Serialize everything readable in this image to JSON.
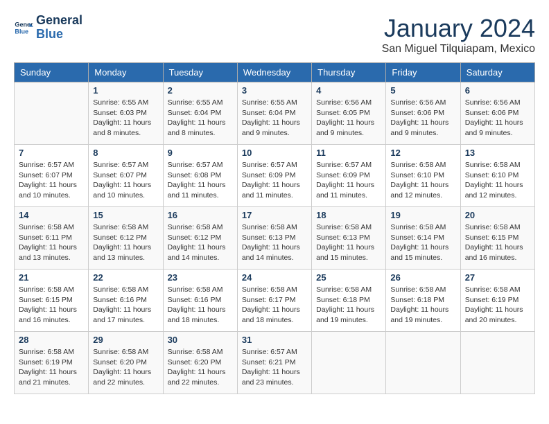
{
  "header": {
    "logo_line1": "General",
    "logo_line2": "Blue",
    "month": "January 2024",
    "location": "San Miguel Tilquiapam, Mexico"
  },
  "weekdays": [
    "Sunday",
    "Monday",
    "Tuesday",
    "Wednesday",
    "Thursday",
    "Friday",
    "Saturday"
  ],
  "weeks": [
    [
      {
        "day": "",
        "info": ""
      },
      {
        "day": "1",
        "info": "Sunrise: 6:55 AM\nSunset: 6:03 PM\nDaylight: 11 hours\nand 8 minutes."
      },
      {
        "day": "2",
        "info": "Sunrise: 6:55 AM\nSunset: 6:04 PM\nDaylight: 11 hours\nand 8 minutes."
      },
      {
        "day": "3",
        "info": "Sunrise: 6:55 AM\nSunset: 6:04 PM\nDaylight: 11 hours\nand 9 minutes."
      },
      {
        "day": "4",
        "info": "Sunrise: 6:56 AM\nSunset: 6:05 PM\nDaylight: 11 hours\nand 9 minutes."
      },
      {
        "day": "5",
        "info": "Sunrise: 6:56 AM\nSunset: 6:06 PM\nDaylight: 11 hours\nand 9 minutes."
      },
      {
        "day": "6",
        "info": "Sunrise: 6:56 AM\nSunset: 6:06 PM\nDaylight: 11 hours\nand 9 minutes."
      }
    ],
    [
      {
        "day": "7",
        "info": "Sunrise: 6:57 AM\nSunset: 6:07 PM\nDaylight: 11 hours\nand 10 minutes."
      },
      {
        "day": "8",
        "info": "Sunrise: 6:57 AM\nSunset: 6:07 PM\nDaylight: 11 hours\nand 10 minutes."
      },
      {
        "day": "9",
        "info": "Sunrise: 6:57 AM\nSunset: 6:08 PM\nDaylight: 11 hours\nand 11 minutes."
      },
      {
        "day": "10",
        "info": "Sunrise: 6:57 AM\nSunset: 6:09 PM\nDaylight: 11 hours\nand 11 minutes."
      },
      {
        "day": "11",
        "info": "Sunrise: 6:57 AM\nSunset: 6:09 PM\nDaylight: 11 hours\nand 11 minutes."
      },
      {
        "day": "12",
        "info": "Sunrise: 6:58 AM\nSunset: 6:10 PM\nDaylight: 11 hours\nand 12 minutes."
      },
      {
        "day": "13",
        "info": "Sunrise: 6:58 AM\nSunset: 6:10 PM\nDaylight: 11 hours\nand 12 minutes."
      }
    ],
    [
      {
        "day": "14",
        "info": "Sunrise: 6:58 AM\nSunset: 6:11 PM\nDaylight: 11 hours\nand 13 minutes."
      },
      {
        "day": "15",
        "info": "Sunrise: 6:58 AM\nSunset: 6:12 PM\nDaylight: 11 hours\nand 13 minutes."
      },
      {
        "day": "16",
        "info": "Sunrise: 6:58 AM\nSunset: 6:12 PM\nDaylight: 11 hours\nand 14 minutes."
      },
      {
        "day": "17",
        "info": "Sunrise: 6:58 AM\nSunset: 6:13 PM\nDaylight: 11 hours\nand 14 minutes."
      },
      {
        "day": "18",
        "info": "Sunrise: 6:58 AM\nSunset: 6:13 PM\nDaylight: 11 hours\nand 15 minutes."
      },
      {
        "day": "19",
        "info": "Sunrise: 6:58 AM\nSunset: 6:14 PM\nDaylight: 11 hours\nand 15 minutes."
      },
      {
        "day": "20",
        "info": "Sunrise: 6:58 AM\nSunset: 6:15 PM\nDaylight: 11 hours\nand 16 minutes."
      }
    ],
    [
      {
        "day": "21",
        "info": "Sunrise: 6:58 AM\nSunset: 6:15 PM\nDaylight: 11 hours\nand 16 minutes."
      },
      {
        "day": "22",
        "info": "Sunrise: 6:58 AM\nSunset: 6:16 PM\nDaylight: 11 hours\nand 17 minutes."
      },
      {
        "day": "23",
        "info": "Sunrise: 6:58 AM\nSunset: 6:16 PM\nDaylight: 11 hours\nand 18 minutes."
      },
      {
        "day": "24",
        "info": "Sunrise: 6:58 AM\nSunset: 6:17 PM\nDaylight: 11 hours\nand 18 minutes."
      },
      {
        "day": "25",
        "info": "Sunrise: 6:58 AM\nSunset: 6:18 PM\nDaylight: 11 hours\nand 19 minutes."
      },
      {
        "day": "26",
        "info": "Sunrise: 6:58 AM\nSunset: 6:18 PM\nDaylight: 11 hours\nand 19 minutes."
      },
      {
        "day": "27",
        "info": "Sunrise: 6:58 AM\nSunset: 6:19 PM\nDaylight: 11 hours\nand 20 minutes."
      }
    ],
    [
      {
        "day": "28",
        "info": "Sunrise: 6:58 AM\nSunset: 6:19 PM\nDaylight: 11 hours\nand 21 minutes."
      },
      {
        "day": "29",
        "info": "Sunrise: 6:58 AM\nSunset: 6:20 PM\nDaylight: 11 hours\nand 22 minutes."
      },
      {
        "day": "30",
        "info": "Sunrise: 6:58 AM\nSunset: 6:20 PM\nDaylight: 11 hours\nand 22 minutes."
      },
      {
        "day": "31",
        "info": "Sunrise: 6:57 AM\nSunset: 6:21 PM\nDaylight: 11 hours\nand 23 minutes."
      },
      {
        "day": "",
        "info": ""
      },
      {
        "day": "",
        "info": ""
      },
      {
        "day": "",
        "info": ""
      }
    ]
  ]
}
